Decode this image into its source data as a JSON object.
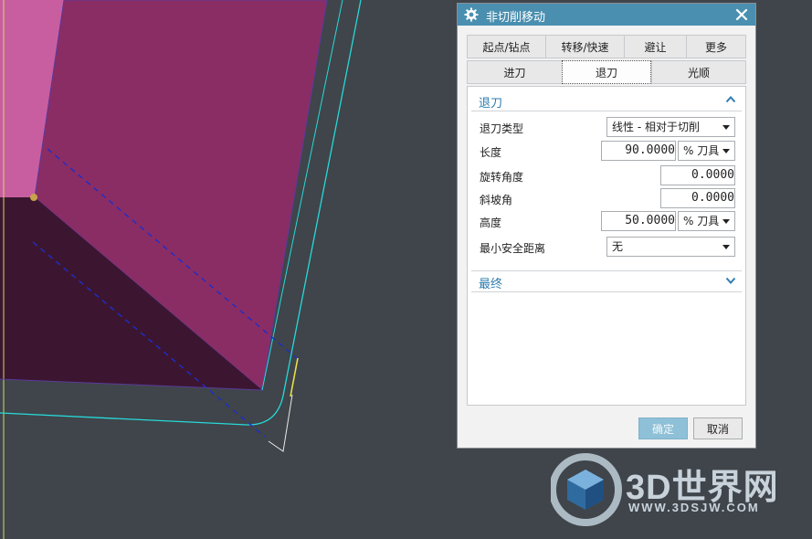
{
  "dialog": {
    "title": "非切削移动",
    "icons": {
      "title": "gear-icon",
      "close": "close-icon"
    },
    "tabs_row1": [
      "起点/钻点",
      "转移/快速",
      "避让",
      "更多"
    ],
    "tabs_row2": [
      "进刀",
      "退刀",
      "光顺"
    ],
    "active_tab": "退刀"
  },
  "retract_group": {
    "header": "退刀",
    "fields": [
      {
        "label": "退刀类型",
        "value": "线性 - 相对于切削"
      },
      {
        "label": "长度",
        "value": "90.0000",
        "unit": "% 刀具"
      },
      {
        "label": "旋转角度",
        "value": "0.0000"
      },
      {
        "label": "斜坡角",
        "value": "0.0000"
      },
      {
        "label": "高度",
        "value": "50.0000",
        "unit": "% 刀具"
      },
      {
        "label": "最小安全距离",
        "value": "无"
      }
    ]
  },
  "final_group": {
    "header": "最终"
  },
  "buttons": {
    "ok": "确定",
    "cancel": "取消"
  },
  "watermark": {
    "brand": "3D世界网",
    "url": "WWW.3DSJW.COM"
  },
  "colors": {
    "title_bar": "#4a8fb0",
    "accent_text": "#2f7db0",
    "background": "#3f454a",
    "part_face_light": "#c85ea0",
    "part_face_mid": "#8a2d65",
    "part_face_dark": "#3c1630",
    "tool_path": "#27d9d9",
    "dashed_path": "#1d2ec8"
  }
}
